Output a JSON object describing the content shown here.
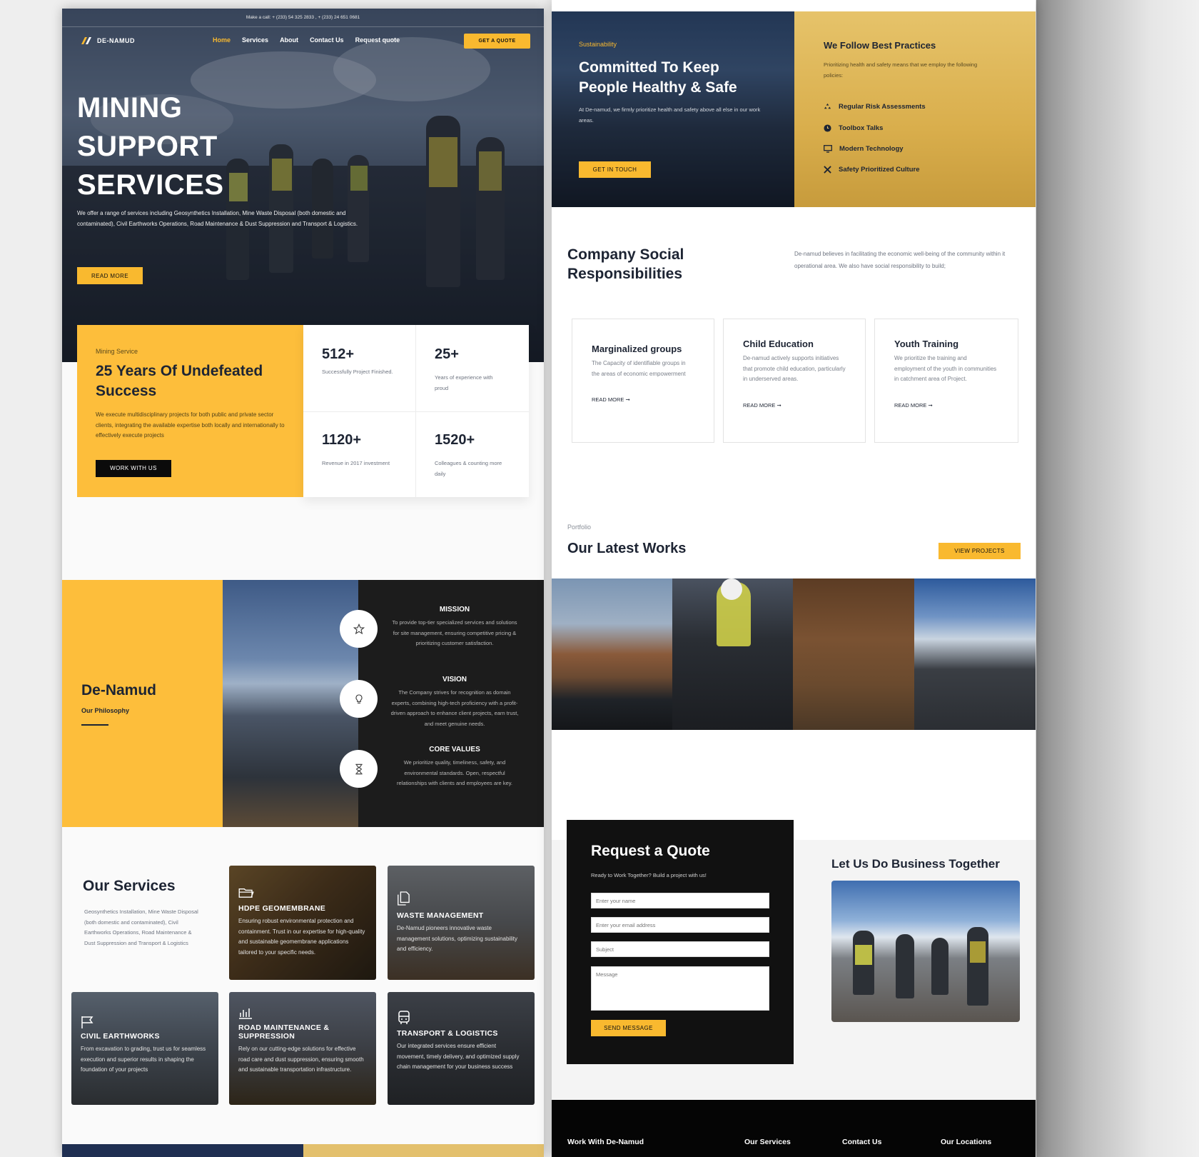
{
  "top_bar": {
    "text": "Make a call: + (233) 54 325 2833 , + (233) 24 651 0681"
  },
  "brand": {
    "name": "DE-NAMUD"
  },
  "nav": {
    "items": [
      "Home",
      "Services",
      "About",
      "Contact Us",
      "Request quote"
    ],
    "cta": "GET A QUOTE"
  },
  "hero": {
    "title_lines": [
      "MINING",
      "SUPPORT",
      "SERVICES"
    ],
    "text": "We offer a range of services including Geosynthetics Installation, Mine Waste Disposal (both domestic and contaminated), Civil Earthworks Operations, Road Maintenance & Dust Suppression and Transport & Logistics.",
    "button": "READ MORE"
  },
  "success": {
    "eyebrow": "Mining Service",
    "title": "25 Years Of Undefeated Success",
    "text": "We execute multidisciplinary projects for both public and private sector clients, integrating the available expertise both locally and internationally to effectively execute projects",
    "button": "WORK WITH US",
    "stats": [
      {
        "value": "512+",
        "label": "Successfully Project Finished."
      },
      {
        "value": "25+",
        "label": "Years of experience with proud"
      },
      {
        "value": "1120+",
        "label": "Revenue in 2017 investment"
      },
      {
        "value": "1520+",
        "label": "Colleagues & counting more daily"
      }
    ]
  },
  "philosophy": {
    "title": "De-Namud",
    "subtitle": "Our Philosophy",
    "items": [
      {
        "heading": "MISSION",
        "text": "To provide top-tier specialized services and solutions for site management, ensuring competitive pricing & prioritizing customer satisfaction.",
        "icon": "star-icon"
      },
      {
        "heading": "VISION",
        "text": "The Company strives for recognition as domain experts, combining high-tech proficiency with a profit-driven approach to enhance client projects, earn trust, and meet genuine needs.",
        "icon": "lightbulb-icon"
      },
      {
        "heading": "CORE VALUES",
        "text": "We prioritize quality, timeliness, safety, and environmental standards. Open, respectful relationships with clients and employees are key.",
        "icon": "hourglass-icon"
      }
    ]
  },
  "services": {
    "title": "Our Services",
    "text": "Geosynthetics Installation, Mine Waste Disposal (both domestic and contaminated), Civil Earthworks Operations, Road Maintenance & Dust Suppression and Transport & Logistics",
    "items": [
      {
        "title": "HDPE GEOMEMBRANE",
        "text": "Ensuring robust environmental protection and containment. Trust in our expertise for high-quality and sustainable geomembrane applications tailored to your specific needs.",
        "icon": "folder-icon"
      },
      {
        "title": "WASTE MANAGEMENT",
        "text": "De-Namud pioneers innovative waste management solutions, optimizing sustainability and efficiency.",
        "icon": "copy-icon"
      },
      {
        "title": "CIVIL EARTHWORKS",
        "text": "From excavation to grading, trust us for seamless execution and superior results in shaping the foundation of your projects",
        "icon": "flag-icon"
      },
      {
        "title": "ROAD MAINTENANCE & SUPPRESSION",
        "text": "Rely on our cutting-edge solutions for effective road care and dust suppression, ensuring smooth and sustainable transportation infrastructure.",
        "icon": "chart-icon"
      },
      {
        "title": "TRANSPORT & LOGISTICS",
        "text": "Our integrated services ensure efficient movement, timely delivery, and optimized supply chain management for your business success",
        "icon": "bus-icon"
      }
    ]
  },
  "sustainability": {
    "eyebrow": "Sustainability",
    "title_lines": [
      "Committed To Keep",
      "People Healthy & Safe"
    ],
    "text": "At De-namud, we firmly prioritize health and safety above all else in our work areas.",
    "button": "GET IN TOUCH",
    "practices_title": "We Follow Best Practices",
    "practices_text": "Prioritizing health and safety means that we employ the following policies:",
    "practices": [
      "Regular Risk Assessments",
      "Toolbox Talks",
      "Modern Technology",
      "Safety Prioritized Culture"
    ]
  },
  "csr": {
    "title_lines": [
      "Company Social",
      "Responsibilities"
    ],
    "text": "De-namud believes in facilitating the economic well-being of the community within it operational area. We also have social responsibility to build;",
    "cards": [
      {
        "title": "Marginalized groups",
        "text": "The Capacity of identifiable groups in the areas of economic empowerment",
        "link": "READ MORE ➞"
      },
      {
        "title": "Child Education",
        "text": "De-namud actively supports initiatives that promote child education, particularly in underserved areas.",
        "link": "READ MORE ➞"
      },
      {
        "title": "Youth Training",
        "text": "We prioritize the training and employment of the youth in communities in catchment area of Project.",
        "link": "READ MORE ➞"
      }
    ]
  },
  "portfolio": {
    "eyebrow": "Portfolio",
    "title": "Our Latest Works",
    "button": "VIEW PROJECTS"
  },
  "quote": {
    "title": "Request a Quote",
    "text": "Ready to Work Together? Build a project with us!",
    "name_placeholder": "Enter your name",
    "email_placeholder": "Enter your email address",
    "subject_placeholder": "Subject",
    "message_placeholder": "Message",
    "button": "SEND MESSAGE",
    "side_title": "Let Us Do Business Together"
  },
  "footer": {
    "columns": [
      "Work With De-Namud",
      "Our Services",
      "Contact Us",
      "Our Locations"
    ]
  },
  "colors": {
    "accent": "#f9b92f",
    "dark": "#111111",
    "navy": "#1d2433"
  }
}
